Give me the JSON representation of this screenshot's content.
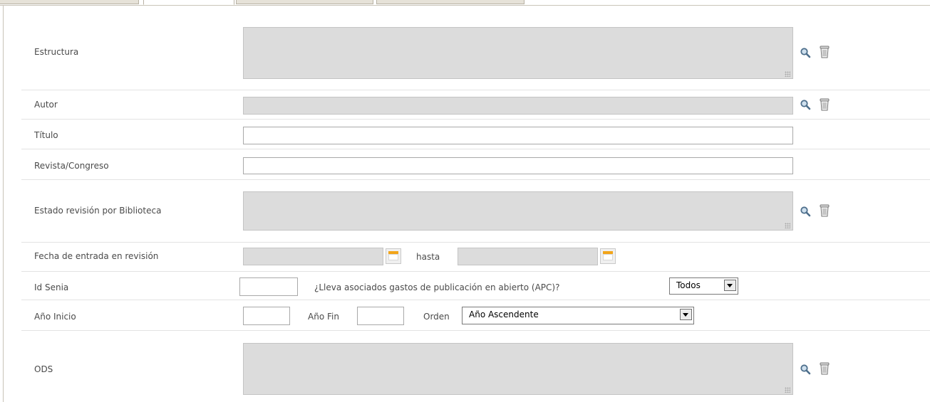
{
  "form": {
    "estructura_label": "Estructura",
    "autor_label": "Autor",
    "titulo_label": "Título",
    "revista_label": "Revista/Congreso",
    "estado_label": "Estado revisión por Biblioteca",
    "fecha_label": "Fecha de entrada en revisión",
    "hasta_label": "hasta",
    "idsenia_label": "Id Senia",
    "apc_label": "¿Lleva asociados gastos de publicación en abierto (APC)?",
    "apc_value": "Todos",
    "anio_inicio_label": "Año Inicio",
    "anio_fin_label": "Año Fin",
    "orden_label": "Orden",
    "orden_value": "Año Ascendente",
    "ods_label": "ODS"
  },
  "icons": {
    "search": "search-icon",
    "delete": "trash-icon",
    "calendar": "calendar-icon"
  },
  "colors": {
    "readonly_field": "#dcdcdc",
    "tab_bg": "#e6e2d8",
    "calendar_accent": "#f2a51a"
  }
}
